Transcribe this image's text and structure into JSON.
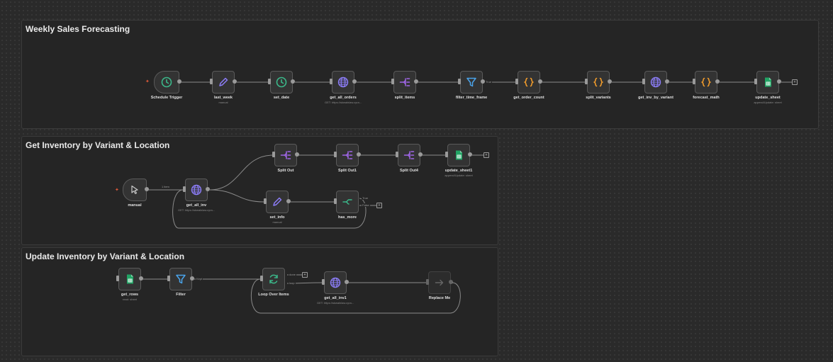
{
  "groups": [
    {
      "title": "Weekly Sales Forecasting"
    },
    {
      "title": "Get Inventory by Variant & Location"
    },
    {
      "title": "Update Inventory by Variant & Location"
    }
  ],
  "g1": {
    "schedule_trigger": {
      "label": "Schedule Trigger"
    },
    "last_week": {
      "label": "last_week",
      "sub": "manual"
    },
    "set_date": {
      "label": "set_date"
    },
    "get_all_orders": {
      "label": "get_all_orders",
      "sub": "GET: https://skwalnlaw.cyra..."
    },
    "split_items": {
      "label": "split_items"
    },
    "filter_time_frame": {
      "label": "filter_time_frame",
      "edge": "True"
    },
    "get_order_count": {
      "label": "get_order_count"
    },
    "split_variants": {
      "label": "split_variants"
    },
    "get_inv_by_variant": {
      "label": "get_inv_by_variant"
    },
    "forecast_math": {
      "label": "forecast_math"
    },
    "update_sheet": {
      "label": "update_sheet",
      "sub": "append/Update: sheet"
    }
  },
  "g2": {
    "manual": {
      "label": "manual",
      "edge": "1 item"
    },
    "get_all_inv": {
      "label": "get_all_inv",
      "sub": "GET: https://skwalnlaw.cyra..."
    },
    "split_out": {
      "label": "Split Out"
    },
    "split_out1": {
      "label": "Split Out1"
    },
    "split_out4": {
      "label": "Split Out4"
    },
    "update_sheet1": {
      "label": "update_sheet1",
      "sub": "append/Update: sheet"
    },
    "set_info": {
      "label": "set_info",
      "sub": "manual"
    },
    "has_more": {
      "label": "has_more",
      "edge_true": "True",
      "edge_false": "False"
    }
  },
  "g3": {
    "get_rows": {
      "label": "get_rows",
      "sub": "read: sheet"
    },
    "filter": {
      "label": "Filter",
      "edge": "Kept"
    },
    "loop": {
      "label": "Loop Over Items",
      "edge_done": "done",
      "edge_loop": "loop"
    },
    "get_all_inv1": {
      "label": "get_all_inv1",
      "sub": "GET: https://skwalnlaw.cyra..."
    },
    "replace_me": {
      "label": "Replace Me"
    }
  },
  "icons": {
    "schedule": "clock-icon",
    "set": "pencil-icon",
    "http": "globe-icon",
    "split": "split-out-icon",
    "filter": "filter-icon",
    "code": "code-braces-icon",
    "sheets": "google-sheets-icon",
    "manual": "cursor-icon",
    "if": "if-branch-icon",
    "loop": "loop-icon",
    "noop": "arrow-right-icon"
  },
  "colors": {
    "green": "#3bb88a",
    "purple": "#8b7cf6",
    "blue": "#4aa3ea",
    "orange": "#f29c2b",
    "sheet": "#21a464",
    "trigger_bolt": "#e05a3a"
  }
}
